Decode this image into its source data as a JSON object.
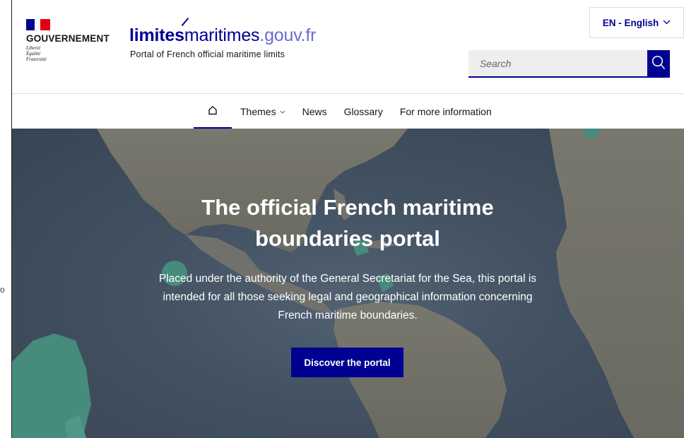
{
  "government": {
    "name": "GOUVERNEMENT",
    "motto": [
      "Liberté",
      "Égalité",
      "Fraternité"
    ]
  },
  "site": {
    "title_part1": "limites",
    "title_part2": "maritimes",
    "title_part3": ".gouv.fr",
    "tagline": "Portal of French official maritime limits"
  },
  "language": {
    "selected": "EN - English",
    "chevron_icon": "chevron-down-icon"
  },
  "search": {
    "placeholder": "Search",
    "icon": "search-icon"
  },
  "nav": {
    "home_icon": "home-icon",
    "items": [
      {
        "label": "Themes"
      },
      {
        "label": "News"
      },
      {
        "label": "Glossary"
      },
      {
        "label": "For more information"
      }
    ]
  },
  "hero": {
    "title_line1": "The official French maritime",
    "title_line2": "boundaries portal",
    "description_line1": "Placed under the authority of the General Secretariat for the Sea, this portal is",
    "description_line2": "intended for all those seeking legal and geographical information concerning",
    "description_line3": "French maritime boundaries.",
    "cta_label": "Discover the portal"
  },
  "stray_char": "o",
  "colors": {
    "brand_blue": "#000091",
    "maritime_zone": "#4fa58e",
    "ocean": "#4a5a6b",
    "land": "#8a8a7e"
  }
}
